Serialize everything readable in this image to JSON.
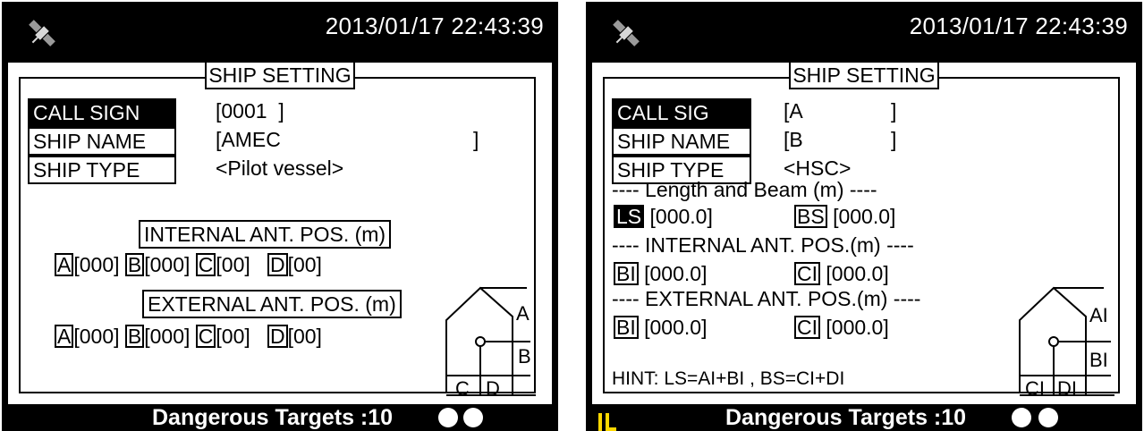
{
  "left": {
    "datetime": "2013/01/17 22:43:39",
    "title": "SHIP SETTING",
    "call_sign_label": "CALL SIGN",
    "call_sign_value": "[0001  ]",
    "ship_name_label": "SHIP NAME",
    "ship_name_value": "[AMEC",
    "ship_name_close": "]",
    "ship_type_label": "SHIP TYPE",
    "ship_type_value": "<Pilot vessel>",
    "internal_header": "INTERNAL ANT. POS. (m)",
    "external_header": "EXTERNAL ANT. POS. (m)",
    "internal": {
      "a_key": "A",
      "a_val": "[000]",
      "b_key": "B",
      "b_val": "[000]",
      "c_key": "C",
      "c_val": "[00]",
      "d_key": "D",
      "d_val": "[00]"
    },
    "external": {
      "a_key": "A",
      "a_val": "[000]",
      "b_key": "B",
      "b_val": "[000]",
      "c_key": "C",
      "c_val": "[00]",
      "d_key": "D",
      "d_val": "[00]"
    },
    "diagram": {
      "a": "A",
      "b": "B",
      "c": "C",
      "d": "D"
    },
    "footer": "Dangerous Targets :10"
  },
  "right": {
    "datetime": "2013/01/17 22:43:39",
    "title": "SHIP SETTING",
    "call_sign_label": "CALL SIG",
    "call_sign_value": "[A",
    "call_sign_close": "]",
    "ship_name_label": "SHIP NAME",
    "ship_name_value": "[B",
    "ship_name_close": "]",
    "ship_type_label": "SHIP TYPE",
    "ship_type_value": "<HSC>",
    "length_beam_header": "---- Length and Beam (m) ----",
    "ls_key": "LS",
    "ls_val": "[000.0]",
    "bs_key": "BS",
    "bs_val": "[000.0]",
    "internal_header": "---- INTERNAL ANT. POS.(m) ----",
    "internal": {
      "bi_key": "BI",
      "bi_val": "[000.0]",
      "ci_key": "CI",
      "ci_val": "[000.0]"
    },
    "external_header": "---- EXTERNAL ANT. POS.(m) ----",
    "external": {
      "bi_key": "BI",
      "bi_val": "[000.0]",
      "ci_key": "CI",
      "ci_val": "[000.0]"
    },
    "hint": "HINT: LS=AI+BI , BS=CI+DI",
    "diagram": {
      "ai": "AI",
      "bi": "BI",
      "ci": "CI",
      "di": "DI"
    },
    "footer": "Dangerous Targets :10"
  },
  "colors": {
    "background": "#000000",
    "screen": "#ffffff",
    "logo": "#ffd800"
  },
  "icons": {
    "status": "satellite-icon",
    "logo": "il-logo-icon",
    "indicator": "white-circle-icon"
  }
}
